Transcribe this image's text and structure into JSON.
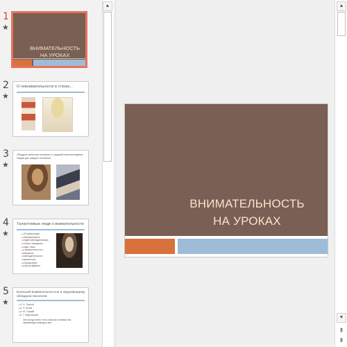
{
  "thumbnails": [
    {
      "number": "1",
      "star": "★",
      "title": "ВНИМАТЕЛЬНОСТЬ НА УРОКАХ",
      "title_line1": "ВНИМАТЕЛЬНОСТЬ",
      "title_line2": "НА УРОКАХ"
    },
    {
      "number": "2",
      "star": "★",
      "title": "О невнимательности в стихах..."
    },
    {
      "number": "3",
      "star": "★",
      "title": "Обсудить качества полезного и трудный понятия важных людей для каждого человека."
    },
    {
      "number": "4",
      "star": "★",
      "title": "Талантливые люди о внимательности",
      "quote": [
        "«Я превосходно",
        "образованным в",
        "людей наблюдательным",
        "полного поведения",
        "люди, лишь",
        "у внимательности к",
        "вниманию,",
        "наблюдательности",
        "щепетильно,",
        "посредством»",
        "(Чарльз Дарвин)"
      ]
    },
    {
      "number": "5",
      "star": "★",
      "title": "Большой внимательностью и окружающему обладали писатели",
      "bullets": [
        "Л. Н. Толстой",
        "А. П. Чехов",
        "А. М. Горький",
        "К. Г. Паустовский"
      ],
      "note": "Они всегда очень точно описали человека или окружающую природу у вас."
    }
  ],
  "main_slide": {
    "title_line1": "ВНИМАТЕЛЬНОСТЬ",
    "title_line2": "НА УРОКАХ"
  },
  "icons": {
    "scroll_up": "▲",
    "scroll_down": "▼",
    "prev_slide": "⇞",
    "next_slide": "⇟"
  },
  "colors": {
    "title_background": "#7a5f54",
    "accent_orange": "#d9713b",
    "accent_blue": "#9ebcd7",
    "title_text": "#f4e6cc",
    "selected_border": "#e7735a",
    "selected_number": "#d24726"
  }
}
